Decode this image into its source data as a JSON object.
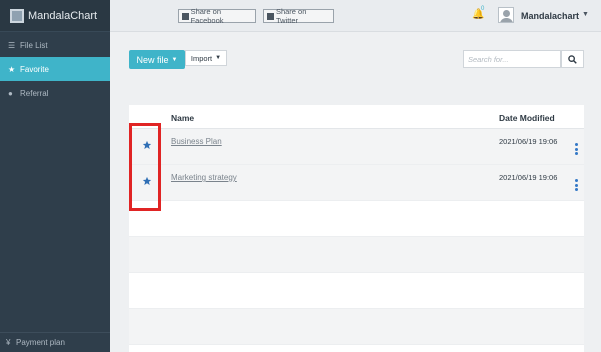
{
  "app": {
    "name": "MandalaChart"
  },
  "sidebar": {
    "items": [
      {
        "label": "File List",
        "icon": "file-list-icon",
        "active": false
      },
      {
        "label": "Favorite",
        "icon": "star-icon",
        "active": true
      },
      {
        "label": "Referral",
        "icon": "user-plus-icon",
        "active": false
      }
    ],
    "footer": {
      "label": "Payment plan",
      "icon": "yen-icon"
    }
  },
  "header": {
    "share_facebook": "Share on Facebook",
    "share_twitter": "Share on Twitter",
    "notification_count": "0",
    "username": "Mandalachart"
  },
  "toolbar": {
    "new_file_label": "New file",
    "import_label": "Import",
    "search_placeholder": "Search for..."
  },
  "table": {
    "columns": {
      "name": "Name",
      "date": "Date Modified"
    },
    "rows": [
      {
        "name": "Business Plan",
        "date": "2021/06/19 19:06",
        "favorite": true
      },
      {
        "name": "Marketing strategy",
        "date": "2021/06/19 19:06",
        "favorite": true
      }
    ]
  },
  "colors": {
    "accent": "#3fb4c9",
    "sidebar": "#2f3e4b",
    "star": "#2f6fb5",
    "highlight": "#e02424"
  }
}
